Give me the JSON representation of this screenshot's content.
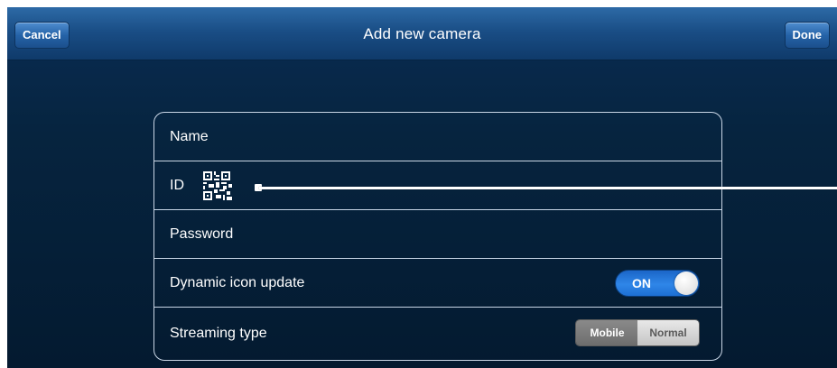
{
  "header": {
    "title": "Add new camera",
    "cancel_label": "Cancel",
    "done_label": "Done"
  },
  "form": {
    "rows": [
      {
        "label": "Name"
      },
      {
        "label": "ID",
        "icon": "qr-code-icon"
      },
      {
        "label": "Password"
      },
      {
        "label": "Dynamic icon update",
        "toggle": {
          "label": "ON",
          "state": "on"
        }
      },
      {
        "label": "Streaming type",
        "segments": [
          "Mobile",
          "Normal"
        ],
        "selected": "Mobile"
      }
    ]
  },
  "colors": {
    "navbar": "#1a4e86",
    "background": "#06243f",
    "toggle_on": "#2f86e8",
    "row_border": "#c9d6e6"
  }
}
